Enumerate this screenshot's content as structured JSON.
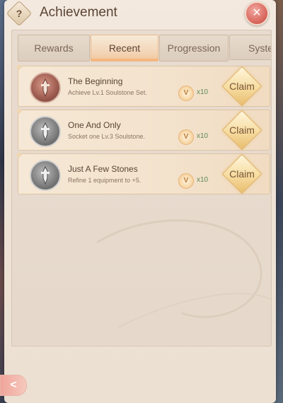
{
  "header": {
    "help_label": "?",
    "title": "Achievement",
    "close_label": "×"
  },
  "tabs": [
    {
      "label": "Rewards",
      "active": false
    },
    {
      "label": "Recent",
      "active": true
    },
    {
      "label": "Progression",
      "active": false
    },
    {
      "label": "System",
      "active": false
    }
  ],
  "achievements": [
    {
      "name": "The Beginning",
      "description": "Achieve Lv.1 Soulstone Set.",
      "medal": "bronze",
      "reward_icon": "V",
      "reward_count": "x10",
      "claim_label": "Claim"
    },
    {
      "name": "One And Only",
      "description": "Socket one Lv.3 Soulstone.",
      "medal": "silver",
      "reward_icon": "V",
      "reward_count": "x10",
      "claim_label": "Claim"
    },
    {
      "name": "Just A Few Stones",
      "description": "Refine 1 equipment to +5.",
      "medal": "silver",
      "reward_icon": "V",
      "reward_count": "x10",
      "claim_label": "Claim"
    }
  ],
  "back_label": "<",
  "colors": {
    "panel_bg": "#efe3d6",
    "tab_active": "#f3d4b5",
    "claim_gold": "#f6dca0",
    "close_red": "#d9675d",
    "reward_green": "#5e8a5a"
  }
}
